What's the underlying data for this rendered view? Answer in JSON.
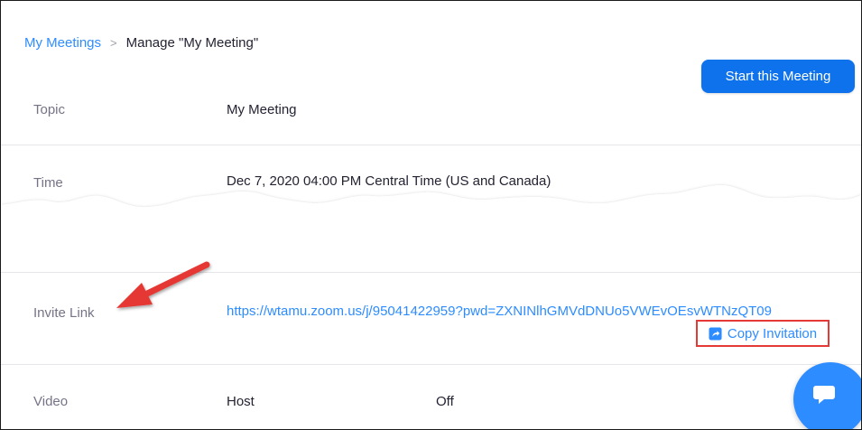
{
  "breadcrumb": {
    "parent": "My Meetings",
    "separator": ">",
    "current": "Manage \"My Meeting\""
  },
  "actions": {
    "start_meeting": "Start this Meeting"
  },
  "fields": {
    "topic": {
      "label": "Topic",
      "value": "My Meeting"
    },
    "time": {
      "label": "Time",
      "value": "Dec 7, 2020 04:00 PM Central Time (US and Canada)"
    },
    "invite_link": {
      "label": "Invite Link",
      "url": "https://wtamu.zoom.us/j/95041422959?pwd=ZXNINlhGMVdDNUo5VWEvOEsvWTNzQT09",
      "copy_label": "Copy Invitation"
    },
    "video": {
      "label": "Video",
      "host_label": "Host",
      "host_value": "Off"
    }
  },
  "colors": {
    "accent": "#2d8cff",
    "button": "#0e72ed",
    "annotation": "#e53935"
  },
  "icons": {
    "copy": "share-icon",
    "chat": "chat-bubble-icon",
    "annotation": "red-arrow-icon"
  }
}
